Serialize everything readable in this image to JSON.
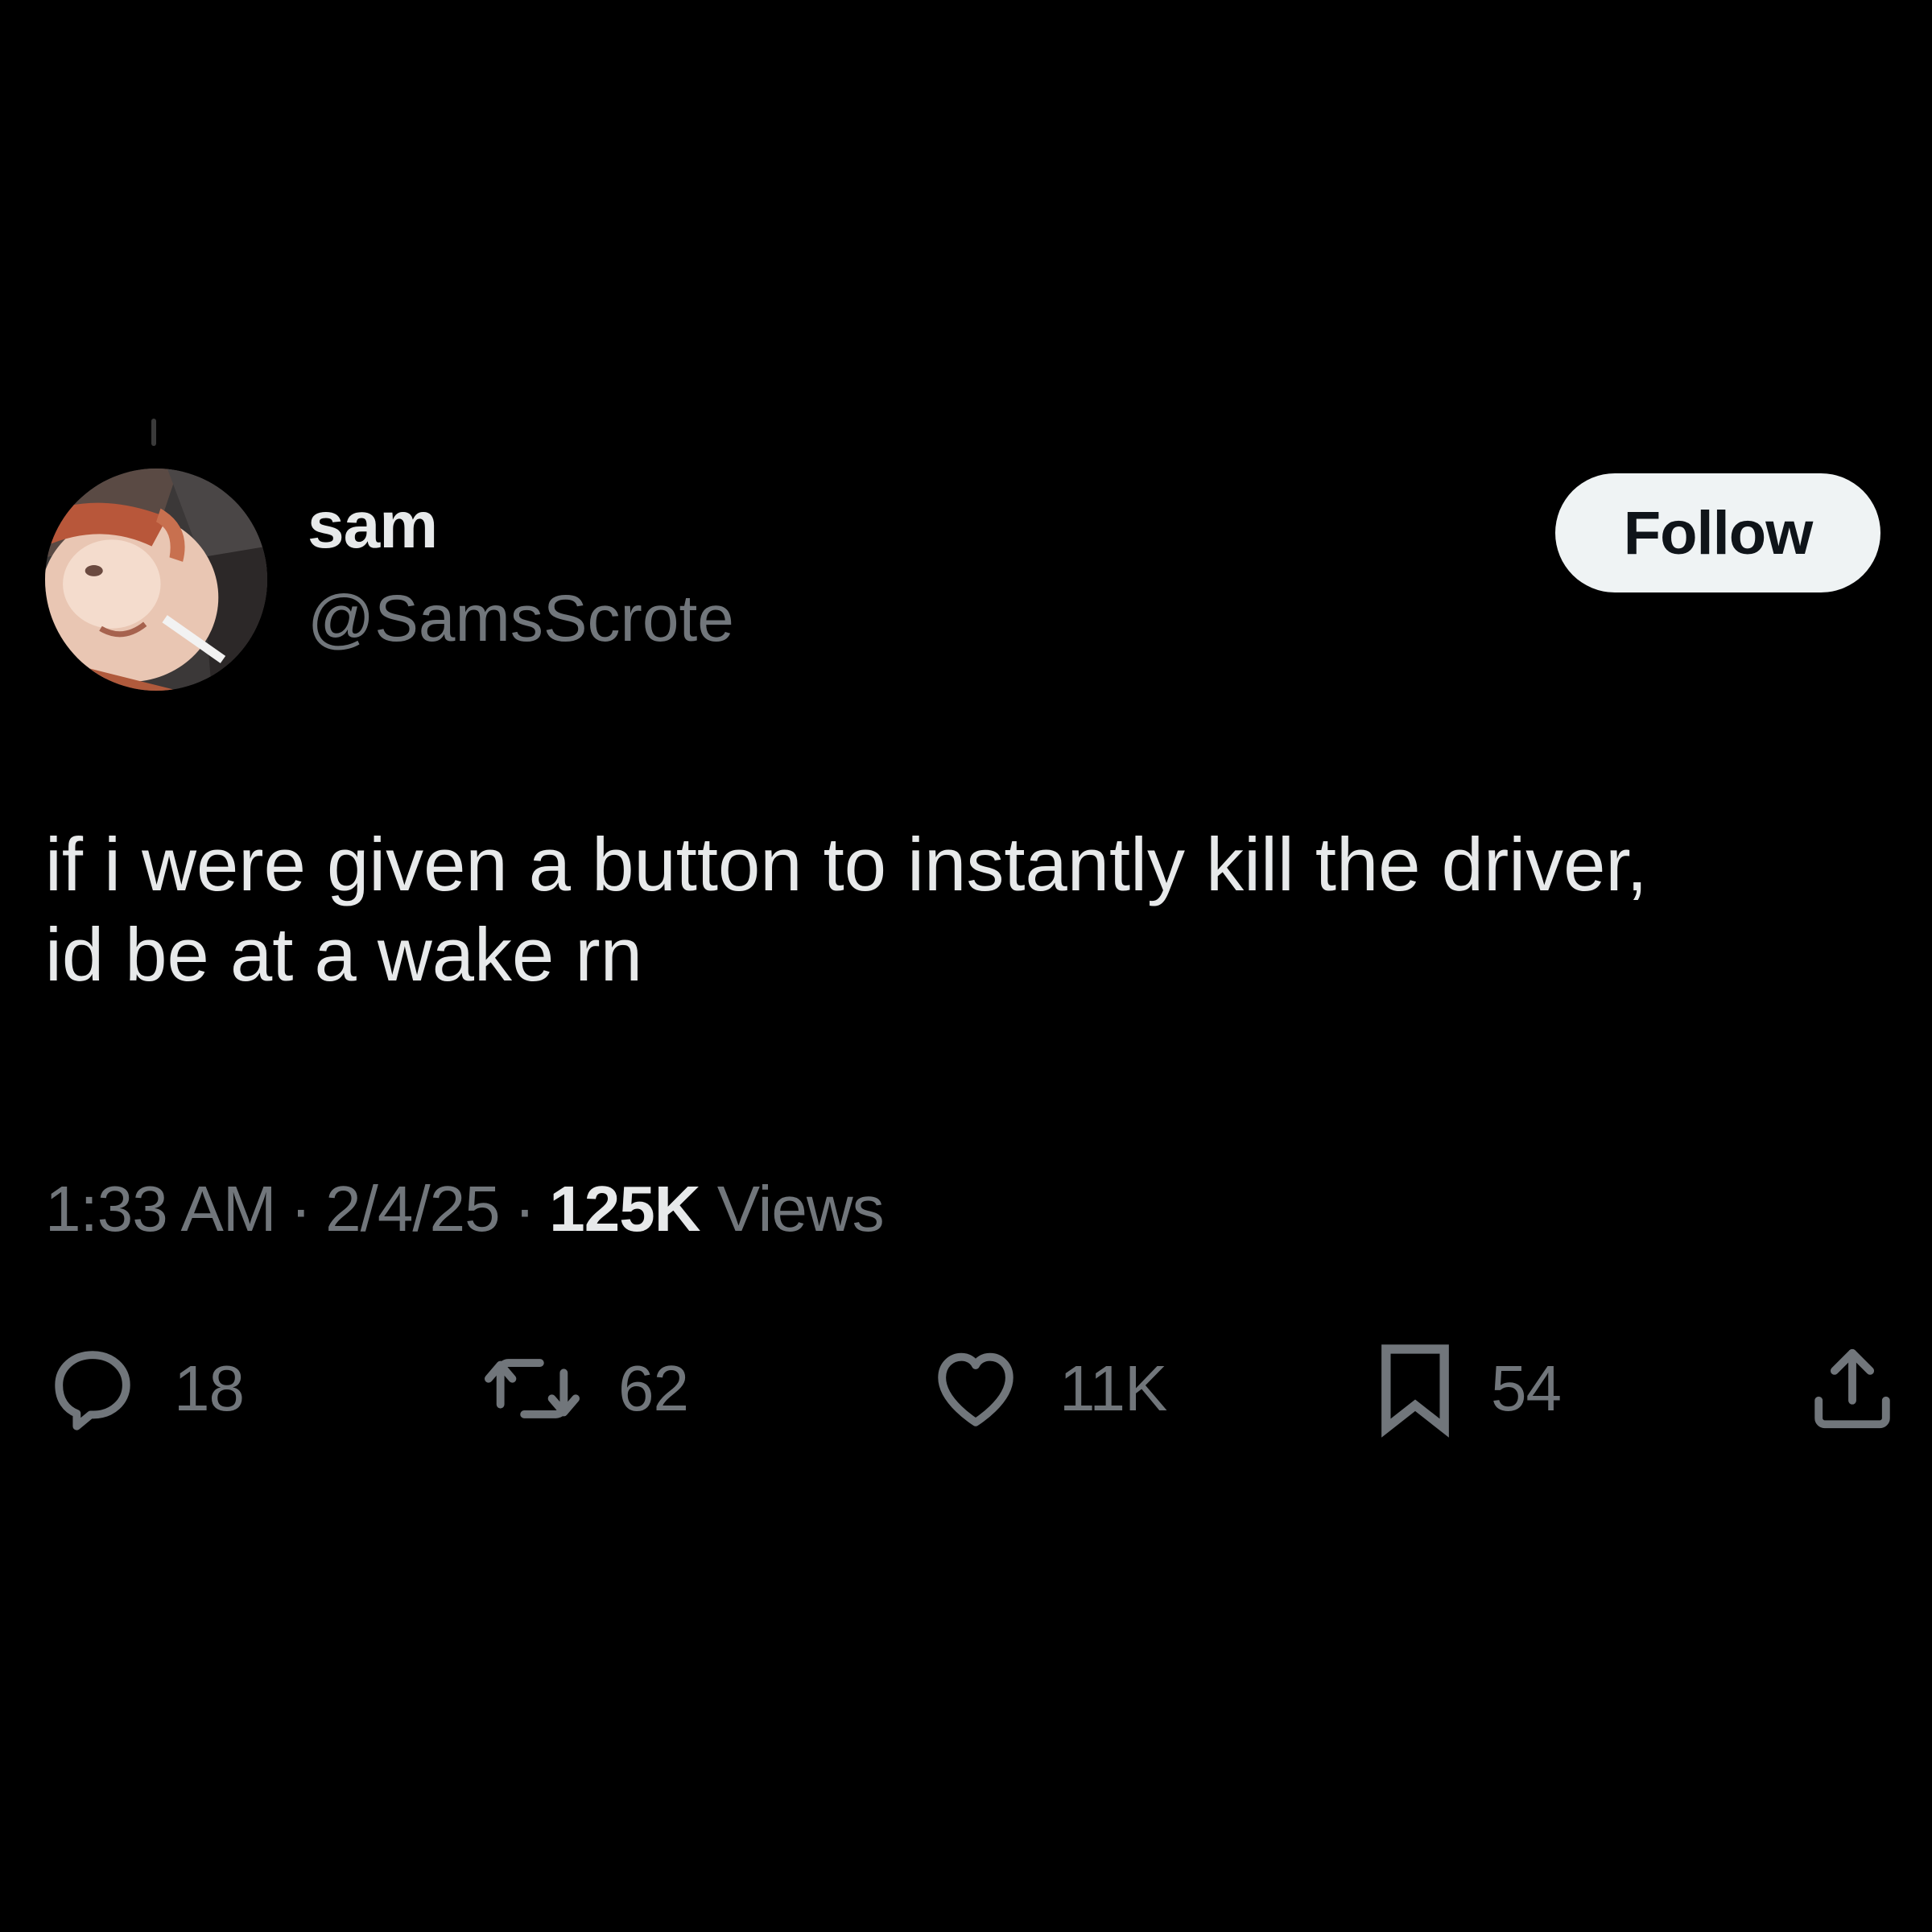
{
  "tweet": {
    "author": {
      "display_name": "sam",
      "handle": "@SamsScrote"
    },
    "follow_label": "Follow",
    "text_lines": [
      "if i were given a button to instantly kill the driver,",
      "id be at a wake rn"
    ],
    "meta": {
      "time": "1:33 AM",
      "separator": "·",
      "date": "2/4/25",
      "views_count": "125K",
      "views_label": "Views"
    },
    "actions": {
      "reply": {
        "icon": "reply-icon",
        "count": "18"
      },
      "repost": {
        "icon": "repost-icon",
        "count": "62"
      },
      "like": {
        "icon": "heart-icon",
        "count": "11K"
      },
      "bookmark": {
        "icon": "bookmark-icon",
        "count": "54"
      },
      "share": {
        "icon": "share-icon"
      }
    }
  },
  "colors": {
    "background": "#000000",
    "primary_text": "#e7e9ea",
    "secondary_text": "#71767b",
    "follow_button_bg": "#eff3f4",
    "follow_button_text": "#0f1419"
  }
}
